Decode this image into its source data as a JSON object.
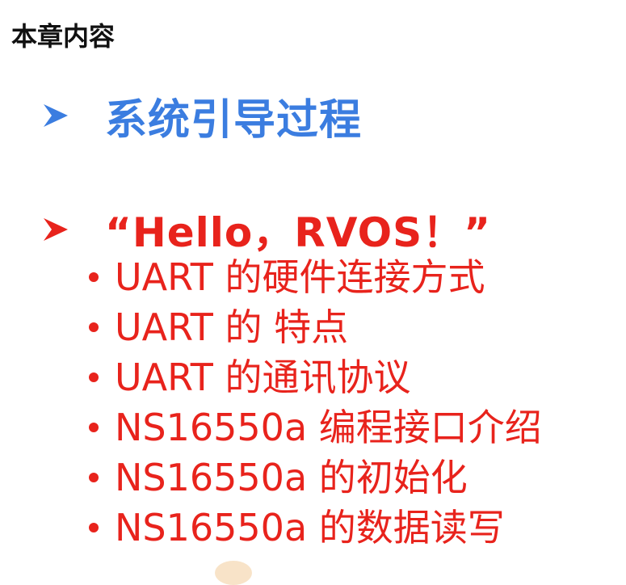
{
  "title": "本章内容",
  "sections": [
    {
      "label": "系统引导过程"
    },
    {
      "label": "“Hello，RVOS！”"
    }
  ],
  "sub_items": [
    "UART 的硬件连接方式",
    "UART 的 特点",
    "UART 的通讯协议",
    "NS16550a 编程接口介绍",
    "NS16550a 的初始化",
    "NS16550a 的数据读写"
  ],
  "colors": {
    "title": "#111111",
    "section_1": "#3b7de0",
    "section_2": "#e8231c",
    "sub_items": "#e8231c"
  },
  "icons": {
    "section_bullet": "arrowhead-icon",
    "sub_bullet": "dot-icon"
  }
}
